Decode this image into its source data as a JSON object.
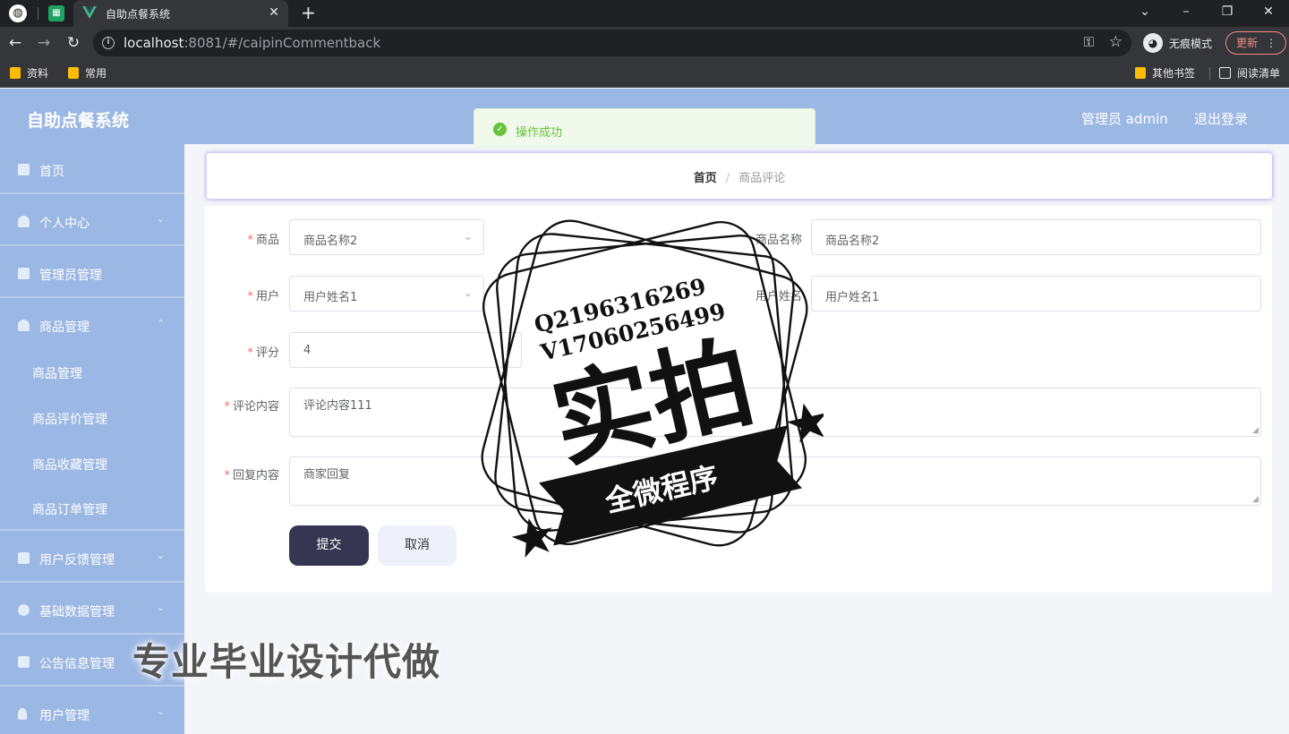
{
  "browser": {
    "tab_title": "自助点餐系统",
    "url_host": "localhost",
    "url_rest": ":8081/#/caipinCommentback",
    "incognito_label": "无痕模式",
    "update_label": "更新",
    "bookmarks": [
      "资料",
      "常用"
    ],
    "bookmarks_right": [
      "其他书签",
      "阅读清单"
    ]
  },
  "header": {
    "title": "自助点餐系统",
    "admin_label": "管理员 admin",
    "logout": "退出登录"
  },
  "toast": {
    "message": "操作成功",
    "color": "#67c23a"
  },
  "sidebar": {
    "items": [
      {
        "label": "首页"
      },
      {
        "label": "个人中心"
      },
      {
        "label": "管理员管理"
      },
      {
        "label": "商品管理"
      }
    ],
    "subitems": [
      {
        "label": "商品管理"
      },
      {
        "label": "商品评价管理"
      },
      {
        "label": "商品收藏管理"
      },
      {
        "label": "商品订单管理"
      }
    ],
    "items_after": [
      {
        "label": "用户反馈管理"
      },
      {
        "label": "基础数据管理"
      },
      {
        "label": "公告信息管理"
      },
      {
        "label": "用户管理"
      }
    ]
  },
  "breadcrumb": {
    "home": "首页",
    "separator": "/",
    "current": "商品评论"
  },
  "form": {
    "product_label": "商品",
    "product_value": "商品名称2",
    "product_name_label": "商品名称",
    "product_name_value": "商品名称2",
    "user_label": "用户",
    "user_value": "用户姓名1",
    "user_name_label": "用户姓名",
    "user_name_value": "用户姓名1",
    "rating_label": "评分",
    "rating_value": "4",
    "comment_label": "评论内容",
    "comment_value": "评论内容111",
    "reply_label": "回复内容",
    "reply_value": "商家回复",
    "submit": "提交",
    "cancel": "取消"
  },
  "stamp": {
    "line1": "Q2196316269",
    "line2": "V17060256499",
    "big": "实拍",
    "banner": "全微程序"
  },
  "watermark": "专业毕业设计代做",
  "colors": {
    "sidebar": "#9bb7e3",
    "submit_bg": "#363652",
    "required": "#f56c6c"
  }
}
